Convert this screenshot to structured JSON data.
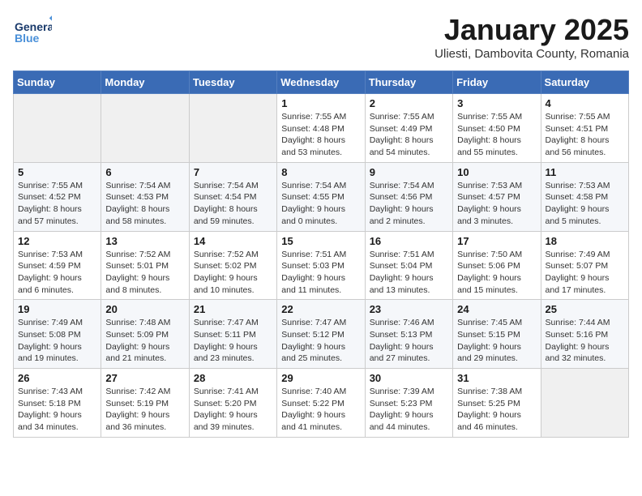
{
  "header": {
    "logo_general": "General",
    "logo_blue": "Blue",
    "month_title": "January 2025",
    "subtitle": "Uliesti, Dambovita County, Romania"
  },
  "weekdays": [
    "Sunday",
    "Monday",
    "Tuesday",
    "Wednesday",
    "Thursday",
    "Friday",
    "Saturday"
  ],
  "weeks": [
    [
      {
        "day": "",
        "info": ""
      },
      {
        "day": "",
        "info": ""
      },
      {
        "day": "",
        "info": ""
      },
      {
        "day": "1",
        "info": "Sunrise: 7:55 AM\nSunset: 4:48 PM\nDaylight: 8 hours and 53 minutes."
      },
      {
        "day": "2",
        "info": "Sunrise: 7:55 AM\nSunset: 4:49 PM\nDaylight: 8 hours and 54 minutes."
      },
      {
        "day": "3",
        "info": "Sunrise: 7:55 AM\nSunset: 4:50 PM\nDaylight: 8 hours and 55 minutes."
      },
      {
        "day": "4",
        "info": "Sunrise: 7:55 AM\nSunset: 4:51 PM\nDaylight: 8 hours and 56 minutes."
      }
    ],
    [
      {
        "day": "5",
        "info": "Sunrise: 7:55 AM\nSunset: 4:52 PM\nDaylight: 8 hours and 57 minutes."
      },
      {
        "day": "6",
        "info": "Sunrise: 7:54 AM\nSunset: 4:53 PM\nDaylight: 8 hours and 58 minutes."
      },
      {
        "day": "7",
        "info": "Sunrise: 7:54 AM\nSunset: 4:54 PM\nDaylight: 8 hours and 59 minutes."
      },
      {
        "day": "8",
        "info": "Sunrise: 7:54 AM\nSunset: 4:55 PM\nDaylight: 9 hours and 0 minutes."
      },
      {
        "day": "9",
        "info": "Sunrise: 7:54 AM\nSunset: 4:56 PM\nDaylight: 9 hours and 2 minutes."
      },
      {
        "day": "10",
        "info": "Sunrise: 7:53 AM\nSunset: 4:57 PM\nDaylight: 9 hours and 3 minutes."
      },
      {
        "day": "11",
        "info": "Sunrise: 7:53 AM\nSunset: 4:58 PM\nDaylight: 9 hours and 5 minutes."
      }
    ],
    [
      {
        "day": "12",
        "info": "Sunrise: 7:53 AM\nSunset: 4:59 PM\nDaylight: 9 hours and 6 minutes."
      },
      {
        "day": "13",
        "info": "Sunrise: 7:52 AM\nSunset: 5:01 PM\nDaylight: 9 hours and 8 minutes."
      },
      {
        "day": "14",
        "info": "Sunrise: 7:52 AM\nSunset: 5:02 PM\nDaylight: 9 hours and 10 minutes."
      },
      {
        "day": "15",
        "info": "Sunrise: 7:51 AM\nSunset: 5:03 PM\nDaylight: 9 hours and 11 minutes."
      },
      {
        "day": "16",
        "info": "Sunrise: 7:51 AM\nSunset: 5:04 PM\nDaylight: 9 hours and 13 minutes."
      },
      {
        "day": "17",
        "info": "Sunrise: 7:50 AM\nSunset: 5:06 PM\nDaylight: 9 hours and 15 minutes."
      },
      {
        "day": "18",
        "info": "Sunrise: 7:49 AM\nSunset: 5:07 PM\nDaylight: 9 hours and 17 minutes."
      }
    ],
    [
      {
        "day": "19",
        "info": "Sunrise: 7:49 AM\nSunset: 5:08 PM\nDaylight: 9 hours and 19 minutes."
      },
      {
        "day": "20",
        "info": "Sunrise: 7:48 AM\nSunset: 5:09 PM\nDaylight: 9 hours and 21 minutes."
      },
      {
        "day": "21",
        "info": "Sunrise: 7:47 AM\nSunset: 5:11 PM\nDaylight: 9 hours and 23 minutes."
      },
      {
        "day": "22",
        "info": "Sunrise: 7:47 AM\nSunset: 5:12 PM\nDaylight: 9 hours and 25 minutes."
      },
      {
        "day": "23",
        "info": "Sunrise: 7:46 AM\nSunset: 5:13 PM\nDaylight: 9 hours and 27 minutes."
      },
      {
        "day": "24",
        "info": "Sunrise: 7:45 AM\nSunset: 5:15 PM\nDaylight: 9 hours and 29 minutes."
      },
      {
        "day": "25",
        "info": "Sunrise: 7:44 AM\nSunset: 5:16 PM\nDaylight: 9 hours and 32 minutes."
      }
    ],
    [
      {
        "day": "26",
        "info": "Sunrise: 7:43 AM\nSunset: 5:18 PM\nDaylight: 9 hours and 34 minutes."
      },
      {
        "day": "27",
        "info": "Sunrise: 7:42 AM\nSunset: 5:19 PM\nDaylight: 9 hours and 36 minutes."
      },
      {
        "day": "28",
        "info": "Sunrise: 7:41 AM\nSunset: 5:20 PM\nDaylight: 9 hours and 39 minutes."
      },
      {
        "day": "29",
        "info": "Sunrise: 7:40 AM\nSunset: 5:22 PM\nDaylight: 9 hours and 41 minutes."
      },
      {
        "day": "30",
        "info": "Sunrise: 7:39 AM\nSunset: 5:23 PM\nDaylight: 9 hours and 44 minutes."
      },
      {
        "day": "31",
        "info": "Sunrise: 7:38 AM\nSunset: 5:25 PM\nDaylight: 9 hours and 46 minutes."
      },
      {
        "day": "",
        "info": ""
      }
    ]
  ]
}
